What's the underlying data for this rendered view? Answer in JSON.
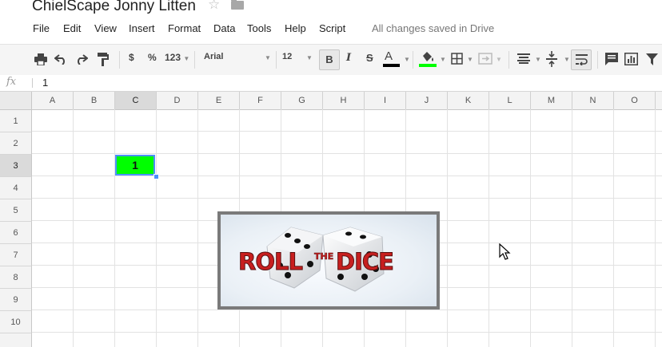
{
  "title": "ChielScape Jonny Litten",
  "menu": [
    "File",
    "Edit",
    "View",
    "Insert",
    "Format",
    "Data",
    "Tools",
    "Help",
    "Script"
  ],
  "save_status": "All changes saved in Drive",
  "toolbar": {
    "currency_label": "$",
    "percent_label": "%",
    "more_formats_label": "123",
    "font_family_value": "Arial",
    "font_size_value": "12",
    "bold_label": "B",
    "italic_label": "I",
    "strike_label": "S",
    "text_color_label": "A",
    "text_color": "#000000",
    "fill_color": "#00ff00"
  },
  "formula_bar": {
    "fx_label": "fx",
    "value": "1"
  },
  "columns": [
    "A",
    "B",
    "C",
    "D",
    "E",
    "F",
    "G",
    "H",
    "I",
    "J",
    "K",
    "L",
    "M",
    "N",
    "O"
  ],
  "rows": [
    "1",
    "2",
    "3",
    "4",
    "5",
    "6",
    "7",
    "8",
    "9",
    "10"
  ],
  "selected_column": "C",
  "selected_row": "3",
  "cells": {
    "C3": {
      "value": "1",
      "background": "#00ff00"
    }
  },
  "image": {
    "text_top_left": "ROLL",
    "text_small": "THE",
    "text_right": "DICE"
  }
}
